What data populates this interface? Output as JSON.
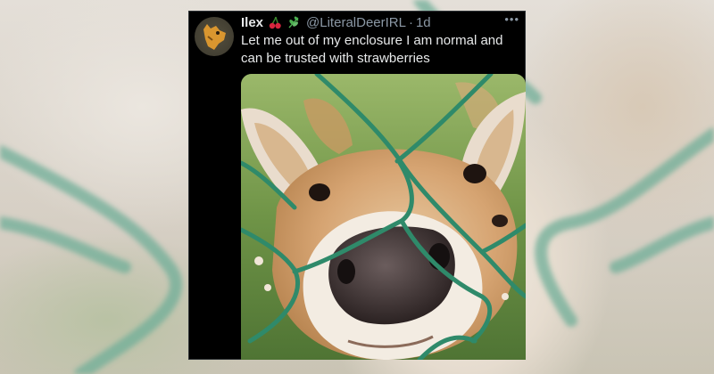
{
  "tweet": {
    "display_name": "Ilex",
    "name_emojis": [
      "cherries-icon",
      "herb-icon"
    ],
    "handle": "@LiteralDeerIRL",
    "separator": "·",
    "timestamp": "1d",
    "more_glyph": "•••",
    "text": "Let me out of my enclosure I am normal and can be trusted with strawberries",
    "avatar": "deer-avatar",
    "media": "deer-nose-through-fence-photo"
  },
  "colors": {
    "tweet_background": "#000000",
    "primary_text": "#e7e9ea",
    "secondary_text": "#8b98a5",
    "fence_wire": "#2f8a6a"
  }
}
